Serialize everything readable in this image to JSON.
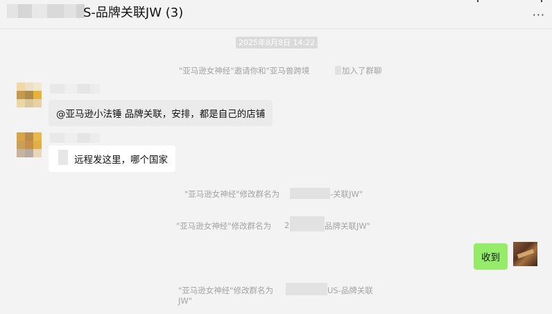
{
  "header": {
    "title": "S-品牌关联JW (3)",
    "more_icon": "···"
  },
  "timestamp": "2025年8月8日 14:22",
  "system_messages": {
    "invite": "\"亚马逊女神经\"邀请你和\"亚马兽跨境",
    "invite_suffix": "加入了群聊",
    "rename1_prefix": "\"亚马逊女神经\"修改群名为",
    "rename1_suffix": "-关联JW\"",
    "rename2_prefix": "\"亚马逊女神经\"修改群名为",
    "rename2_mid": "2",
    "rename2_suffix": "品牌关联JW\"",
    "rename3_prefix": "\"亚马逊女神经\"修改群名为",
    "rename3_suffix": "US-品牌关联",
    "rename3_line2": "JW\""
  },
  "messages": [
    {
      "text": "@亚马逊小法锤 品牌关联，安排，都是自己的店铺"
    },
    {
      "text": "远程发这里，哪个国家"
    },
    {
      "text": "收到"
    }
  ],
  "colors": {
    "background": "#f3f3f3",
    "outgoing_bubble": "#95ec69",
    "incoming_bubble": "#ebebeb",
    "system_text": "#a3a3a3",
    "timestamp_bg": "#dadada"
  },
  "avatars": {
    "a1": [
      "#f0d8a8",
      "#ede0c6",
      "#f2e7cf",
      "#c49a4e",
      "#b08b4c",
      "#e6b237",
      "#ead7a6",
      "#d9c79e",
      "#e7d2a8"
    ],
    "a2": [
      "#d6a54a",
      "#b98d4b",
      "#e8b84a",
      "#caa058",
      "#c6904a",
      "#e1b044",
      "#c8b3a0",
      "#b8a9a1",
      "#e8d7b8"
    ]
  }
}
